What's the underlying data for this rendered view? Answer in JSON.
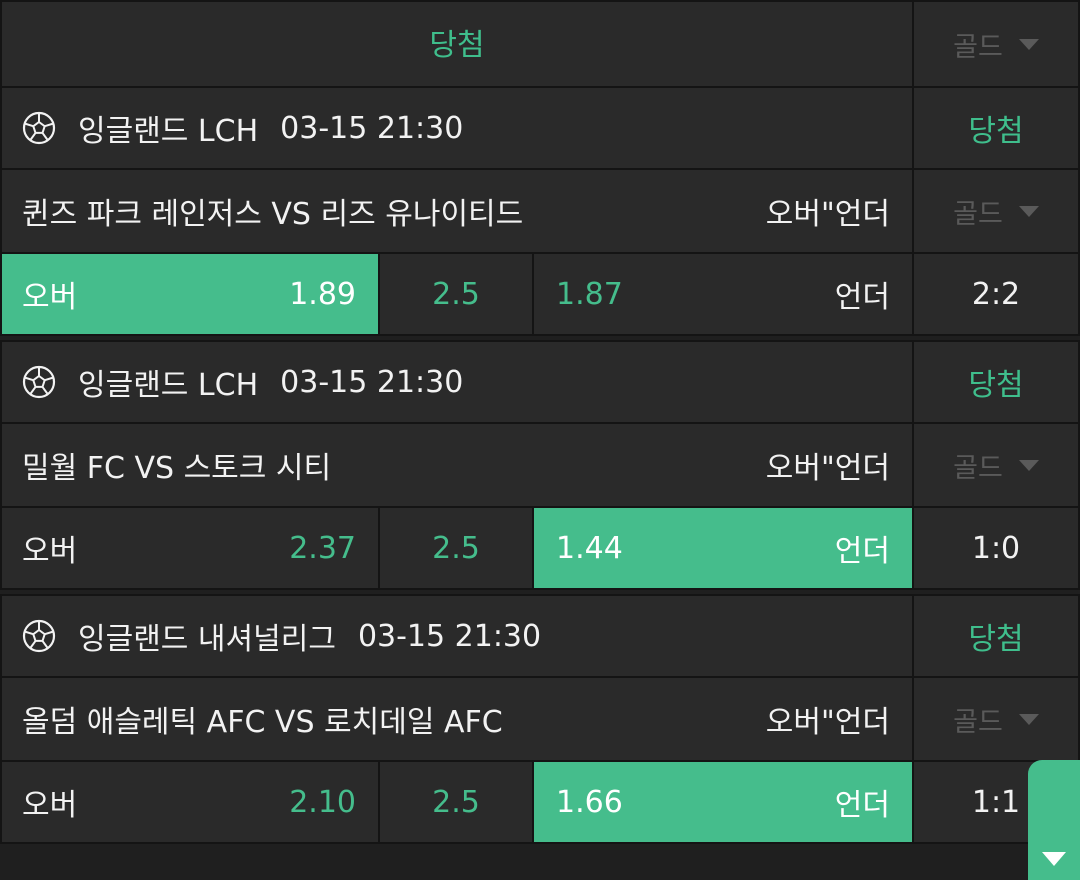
{
  "header": {
    "status": "당첨",
    "gold": "골드"
  },
  "matches": [
    {
      "league": "잉글랜드 LCH",
      "datetime": "03-15 21:30",
      "status": "당첨",
      "teams": "퀸즈 파크 레인저스 VS 리즈 유나이티드",
      "bet_type": "오버\"언더",
      "gold": "골드",
      "over_label": "오버",
      "over_odds": "1.89",
      "line": "2.5",
      "under_odds": "1.87",
      "under_label": "언더",
      "score": "2:2",
      "selected": "over"
    },
    {
      "league": "잉글랜드 LCH",
      "datetime": "03-15 21:30",
      "status": "당첨",
      "teams": "밀월 FC VS 스토크 시티",
      "bet_type": "오버\"언더",
      "gold": "골드",
      "over_label": "오버",
      "over_odds": "2.37",
      "line": "2.5",
      "under_odds": "1.44",
      "under_label": "언더",
      "score": "1:0",
      "selected": "under"
    },
    {
      "league": "잉글랜드 내셔널리그",
      "datetime": "03-15 21:30",
      "status": "당첨",
      "teams": "올덤 애슬레틱 AFC VS 로치데일 AFC",
      "bet_type": "오버\"언더",
      "gold": "골드",
      "over_label": "오버",
      "over_odds": "2.10",
      "line": "2.5",
      "under_odds": "1.66",
      "under_label": "언더",
      "score": "1:1",
      "selected": "under"
    }
  ],
  "icons": {
    "sport": "soccer-ball-icon",
    "dropdown": "chevron-down-icon",
    "scroll": "scroll-down-icon"
  },
  "colors": {
    "accent": "#45bd8c",
    "background": "#2a2a2a",
    "muted": "#5a5a5a"
  }
}
